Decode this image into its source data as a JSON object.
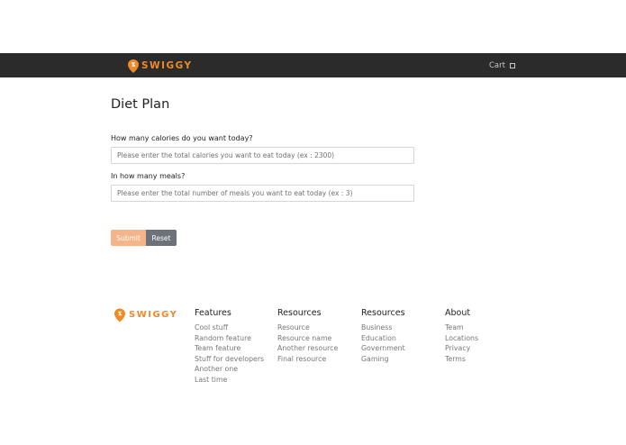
{
  "brand": {
    "name": "SWIGGY",
    "color": "#f08a24"
  },
  "nav": {
    "cart_label": "Cart",
    "background": "#2b2b2b"
  },
  "page": {
    "title": "Diet Plan"
  },
  "form": {
    "calories_label": "How many calories do you want today?",
    "calories_placeholder": "Please enter the total calories you want to eat today (ex : 2300)",
    "calories_value": "",
    "meals_label": "In how many meals?",
    "meals_placeholder": "Please enter the total number of meals you want to eat today (ex : 3)",
    "meals_value": "",
    "submit_label": "Submit",
    "reset_label": "Reset"
  },
  "footer": {
    "columns": [
      {
        "heading": "Features",
        "items": [
          "Cool stuff",
          "Random feature",
          "Team feature",
          "Stuff for developers",
          "Another one",
          "Last time"
        ]
      },
      {
        "heading": "Resources",
        "items": [
          "Resource",
          "Resource name",
          "Another resource",
          "Final resource"
        ]
      },
      {
        "heading": "Resources",
        "items": [
          "Business",
          "Education",
          "Government",
          "Gaming"
        ]
      },
      {
        "heading": "About",
        "items": [
          "Team",
          "Locations",
          "Privacy",
          "Terms"
        ]
      }
    ]
  }
}
